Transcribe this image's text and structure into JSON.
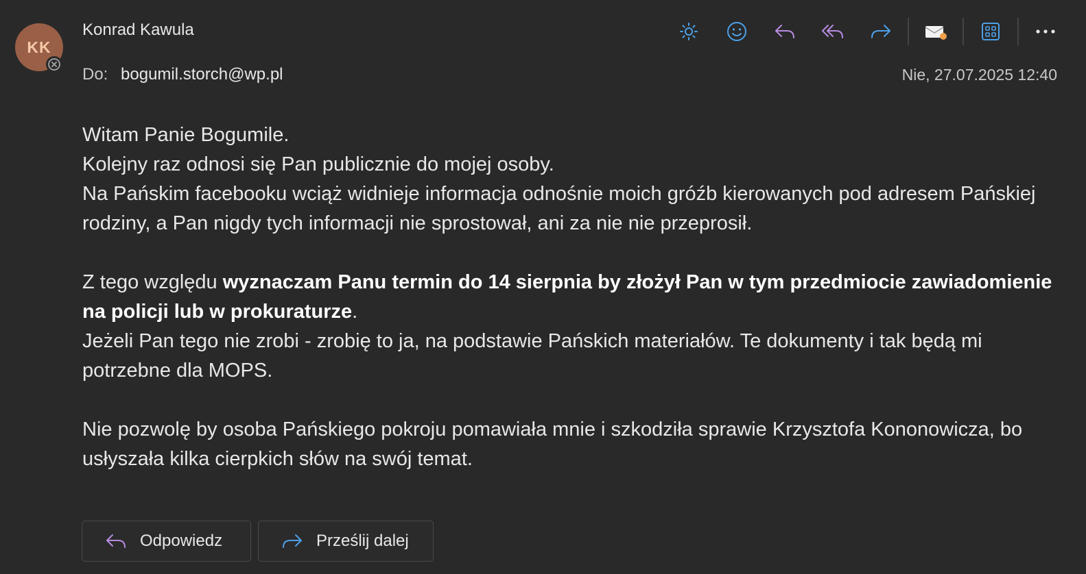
{
  "message": {
    "sender_initials": "KK",
    "sender_name": "Konrad Kawula",
    "to_label": "Do:",
    "to_address": "bogumil.storch@wp.pl",
    "date": "Nie, 27.07.2025 12:40"
  },
  "toolbar": {
    "icons": [
      "brightness-icon",
      "emoji-icon",
      "reply-icon",
      "reply-all-icon",
      "forward-icon",
      "mark-message-icon",
      "apps-icon",
      "more-icon"
    ]
  },
  "body": {
    "line1": "Witam Panie Bogumile.",
    "line2": "Kolejny raz odnosi się Pan publicznie do mojej osoby.",
    "line3": "Na Pańskim facebooku wciąż widnieje informacja odnośnie moich gróźb kierowanych pod adresem Pańskiej rodziny, a Pan nigdy tych informacji nie sprostował, ani za nie nie przeprosił.",
    "p2_pre": "Z tego względu ",
    "p2_bold": "wyznaczam Panu termin do 14 sierpnia by złożył Pan w tym przedmiocie zawiadomienie na policji lub w prokuraturze",
    "p2_post": ".",
    "p2_line2": "Jeżeli Pan tego nie zrobi - zrobię to ja, na podstawie Pańskich materiałów. Te dokumenty i tak będą mi potrzebne dla MOPS.",
    "p3": "Nie pozwolę by osoba Pańskiego pokroju pomawiała mnie i szkodziła sprawie Krzysztofa Kononowicza, bo usłyszała kilka cierpkich słów na swój temat."
  },
  "actions": {
    "reply_label": "Odpowiedz",
    "forward_label": "Prześlij dalej"
  },
  "colors": {
    "background": "#292929",
    "accent_blue": "#4ea0e8",
    "accent_purple": "#b78be0",
    "avatar_bg": "#9a5f47"
  }
}
